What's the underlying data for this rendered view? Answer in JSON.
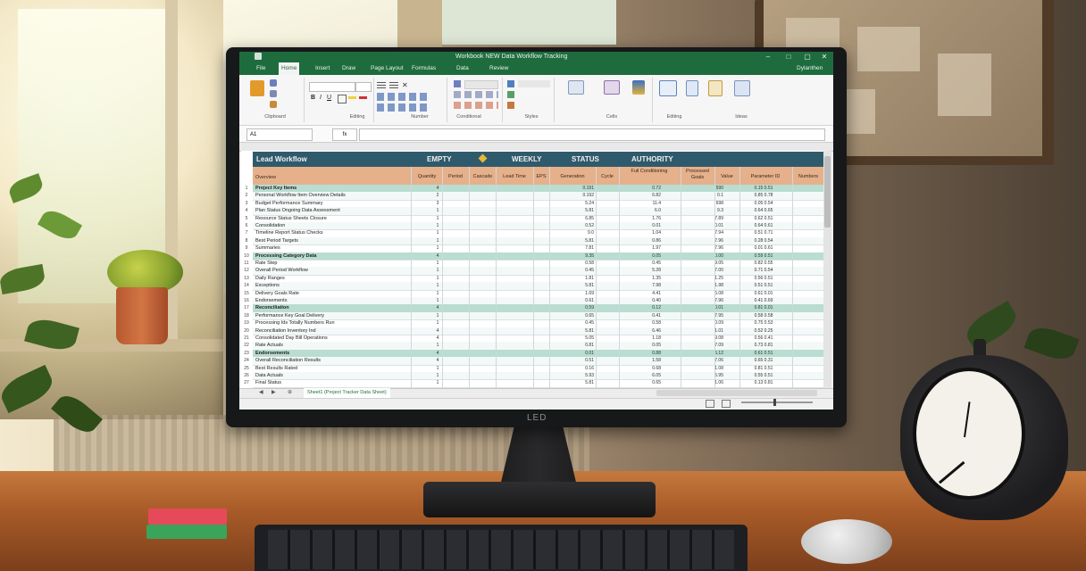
{
  "scene": {
    "monitor_brand": "LED",
    "clock_brand": "",
    "colors": {
      "excel_green": "#1e6c3e",
      "banner": "#2f5a6c",
      "header_peach": "#e6b08a",
      "section_mint": "#b9ddd0"
    }
  },
  "excel": {
    "title": "Workbook NEW Data Workflow Tracking",
    "account": "Dylanthen",
    "tabs": [
      "File",
      "Home",
      "Insert",
      "Draw",
      "Page Layout",
      "Formulas",
      "Data",
      "Review"
    ],
    "active_tab": "Home",
    "ribbon_groups": [
      "Clipboard",
      "Editing",
      "Number",
      "Conditional",
      "Styles",
      "Cells",
      "Editing",
      "Ideas"
    ],
    "name_box": "A1",
    "fx": "fx",
    "sheet_tab": "Sheet1 (Project Tracker Data Sheet)",
    "sheet": {
      "banner": [
        "Lead Workflow",
        "EMPTY",
        "WEEKLY",
        "STATUS",
        "AUTHORITY"
      ],
      "columns": [
        "Overview",
        "Quantity",
        "Period",
        "Cascade",
        "Lead Time",
        "EPS",
        "Generation",
        "Cycle",
        "Full Conditioning",
        "Processed Goals",
        "Value",
        "Parameter ID",
        "Numbers"
      ],
      "rows": [
        {
          "n": "1",
          "a": "Project Key Items",
          "b": "4",
          "f": "0.191",
          "h": "0.72",
          "i": "590",
          "k": "0.15 0.51",
          "sec": true
        },
        {
          "n": "2",
          "a": "Personal Workflow Item Overview Details",
          "b": "2",
          "f": "0.192",
          "h": "6.82",
          "i": "0.1",
          "k": "0.85 0.78"
        },
        {
          "n": "3",
          "a": "Budget Performance Summary",
          "b": "3",
          "f": "5.24",
          "h": "11.4",
          "i": "698",
          "k": "0.05 0.54"
        },
        {
          "n": "4",
          "a": "Plan Status Ongoing Data Assessment",
          "b": "1",
          "f": "5.81",
          "h": "6.0",
          "i": "9.3",
          "k": "0.64 0.65"
        },
        {
          "n": "5",
          "a": "Resource Status Sheets Closure",
          "b": "1",
          "f": "6.85",
          "h": "1.76",
          "i": "7.89",
          "k": "0.62 0.51"
        },
        {
          "n": "6",
          "a": "Consolidation",
          "b": "1",
          "f": "0.52",
          "h": "0.01",
          "i": "0.01",
          "k": "0.64 0.61"
        },
        {
          "n": "7",
          "a": "Timeline Report Status Checks",
          "b": "1",
          "f": "9.0",
          "h": "1.04",
          "i": "7.94",
          "k": "0.51 0.71"
        },
        {
          "n": "8",
          "a": "Best Period Targets",
          "b": "1",
          "f": "5.81",
          "h": "0.86",
          "i": "7.96",
          "k": "0.28 0.54"
        },
        {
          "n": "9",
          "a": "Summaries",
          "b": "1",
          "f": "7.81",
          "h": "1.97",
          "i": "7.96",
          "k": "0.01 0.61"
        },
        {
          "n": "10",
          "a": "Processing Category Data",
          "b": "4",
          "f": "9.35",
          "h": "0.05",
          "i": "0.00",
          "k": "0.59 0.51",
          "sec": true
        },
        {
          "n": "11",
          "a": "Rate Step",
          "b": "1",
          "f": "0.58",
          "h": "0.45",
          "i": "9.05",
          "k": "0.82 0.55"
        },
        {
          "n": "12",
          "a": "Overall Period Workflow",
          "b": "1",
          "f": "0.45",
          "h": "5.28",
          "i": "7.00",
          "k": "0.71 0.54"
        },
        {
          "n": "13",
          "a": "Daily Ranges",
          "b": "1",
          "f": "1.81",
          "h": "1.35",
          "i": "1.25",
          "k": "0.56 0.51"
        },
        {
          "n": "14",
          "a": "Exceptions",
          "b": "1",
          "f": "5.81",
          "h": "7.98",
          "i": "1.98",
          "k": "0.51 0.51"
        },
        {
          "n": "15",
          "a": "Delivery Goals Rate",
          "b": "1",
          "f": "1.69",
          "h": "4.41",
          "i": "5.08",
          "k": "0.61 0.01"
        },
        {
          "n": "16",
          "a": "Endorsements",
          "b": "1",
          "f": "0.61",
          "h": "0.40",
          "i": "7.96",
          "k": "0.41 0.69"
        },
        {
          "n": "17",
          "a": "Reconciliation",
          "b": "4",
          "f": "0.59",
          "h": "0.12",
          "i": "0.01",
          "k": "0.81 0.01",
          "sec": true
        },
        {
          "n": "18",
          "a": "Performance Key Goal Delivery",
          "b": "1",
          "f": "0.65",
          "h": "0.41",
          "i": "7.95",
          "k": "0.58 0.58"
        },
        {
          "n": "19",
          "a": "Processing Ids Totally Numbers Run",
          "b": "1",
          "f": "0.45",
          "h": "0.58",
          "i": "0.09",
          "k": "0.75 0.53"
        },
        {
          "n": "20",
          "a": "Reconciliation Inventory Ind",
          "b": "4",
          "f": "5.81",
          "h": "6.46",
          "i": "1.01",
          "k": "0.52 0.25"
        },
        {
          "n": "21",
          "a": "Consolidated Day Bill Operations",
          "b": "4",
          "f": "5.05",
          "h": "1.18",
          "i": "9.08",
          "k": "0.56 0.41"
        },
        {
          "n": "22",
          "a": "Rate Actuals",
          "b": "1",
          "f": "0.81",
          "h": "0.05",
          "i": "7.09",
          "k": "0.73 0.81"
        },
        {
          "n": "23",
          "a": "Endorsements",
          "b": "4",
          "f": "0.01",
          "h": "0.88",
          "i": "5.12",
          "k": "0.61 0.51",
          "sec": true
        },
        {
          "n": "24",
          "a": "Overall Reconciliation Results",
          "b": "4",
          "f": "0.51",
          "h": "1.58",
          "i": "7.06",
          "k": "0.65 0.31"
        },
        {
          "n": "25",
          "a": "Best Results Rated",
          "b": "1",
          "f": "0.16",
          "h": "0.68",
          "i": "1.08",
          "k": "0.81 0.51"
        },
        {
          "n": "26",
          "a": "Data Actuals",
          "b": "1",
          "f": "5.93",
          "h": "6.05",
          "i": "5.95",
          "k": "0.55 0.51"
        },
        {
          "n": "27",
          "a": "Final Status",
          "b": "1",
          "f": "5.81",
          "h": "0.65",
          "i": "1.06",
          "k": "0.13 0.81"
        }
      ]
    }
  }
}
